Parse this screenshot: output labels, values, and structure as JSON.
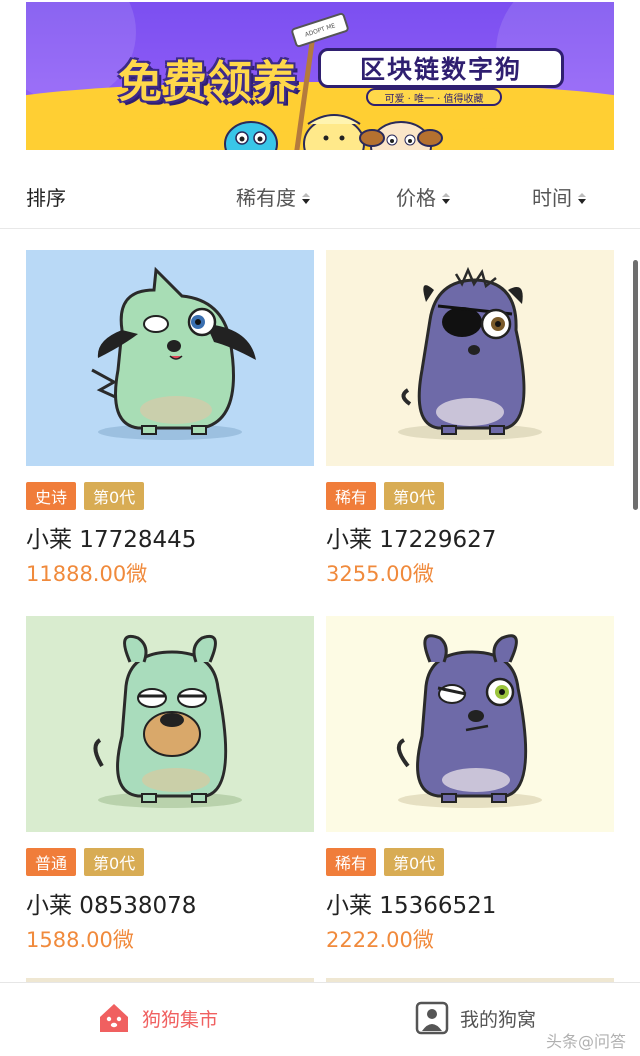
{
  "banner": {
    "title_big": "免费领养",
    "title_small": "区块链数字狗",
    "tagline": "可爱 · 唯一 · 值得收藏",
    "sign": "ADOPT ME"
  },
  "sort": {
    "label": "排序",
    "options": [
      "稀有度",
      "价格",
      "时间"
    ]
  },
  "cards": [
    {
      "rarity": "史诗",
      "generation": "第0代",
      "name": "小莱 17728445",
      "price": "11888.00微",
      "bg": "#b9d9f6",
      "dog_color": "#a8ddb5",
      "dog_shade": "#8fc79f"
    },
    {
      "rarity": "稀有",
      "generation": "第0代",
      "name": "小莱 17229627",
      "price": "3255.00微",
      "bg": "#fbf4dc",
      "dog_color": "#6e6aa8",
      "dog_shade": "#5a5690"
    },
    {
      "rarity": "普通",
      "generation": "第0代",
      "name": "小莱 08538078",
      "price": "1588.00微",
      "bg": "#d9eccf",
      "dog_color": "#a9dcbc",
      "dog_shade": "#8fc8a4"
    },
    {
      "rarity": "稀有",
      "generation": "第0代",
      "name": "小莱 15366521",
      "price": "2222.00微",
      "bg": "#fdfbe4",
      "dog_color": "#6e6aa8",
      "dog_shade": "#5a5690"
    }
  ],
  "nav": {
    "market": "狗狗集市",
    "my_kennel": "我的狗窝"
  },
  "watermark": "头条@问答",
  "colors": {
    "accent": "#f08a3c",
    "rare_badge": "#f07d3a",
    "gen_badge": "#d8ac54",
    "nav_active": "#f06060"
  },
  "icons": [
    "caret-sort-icon",
    "dog-house-icon",
    "user-card-icon"
  ]
}
